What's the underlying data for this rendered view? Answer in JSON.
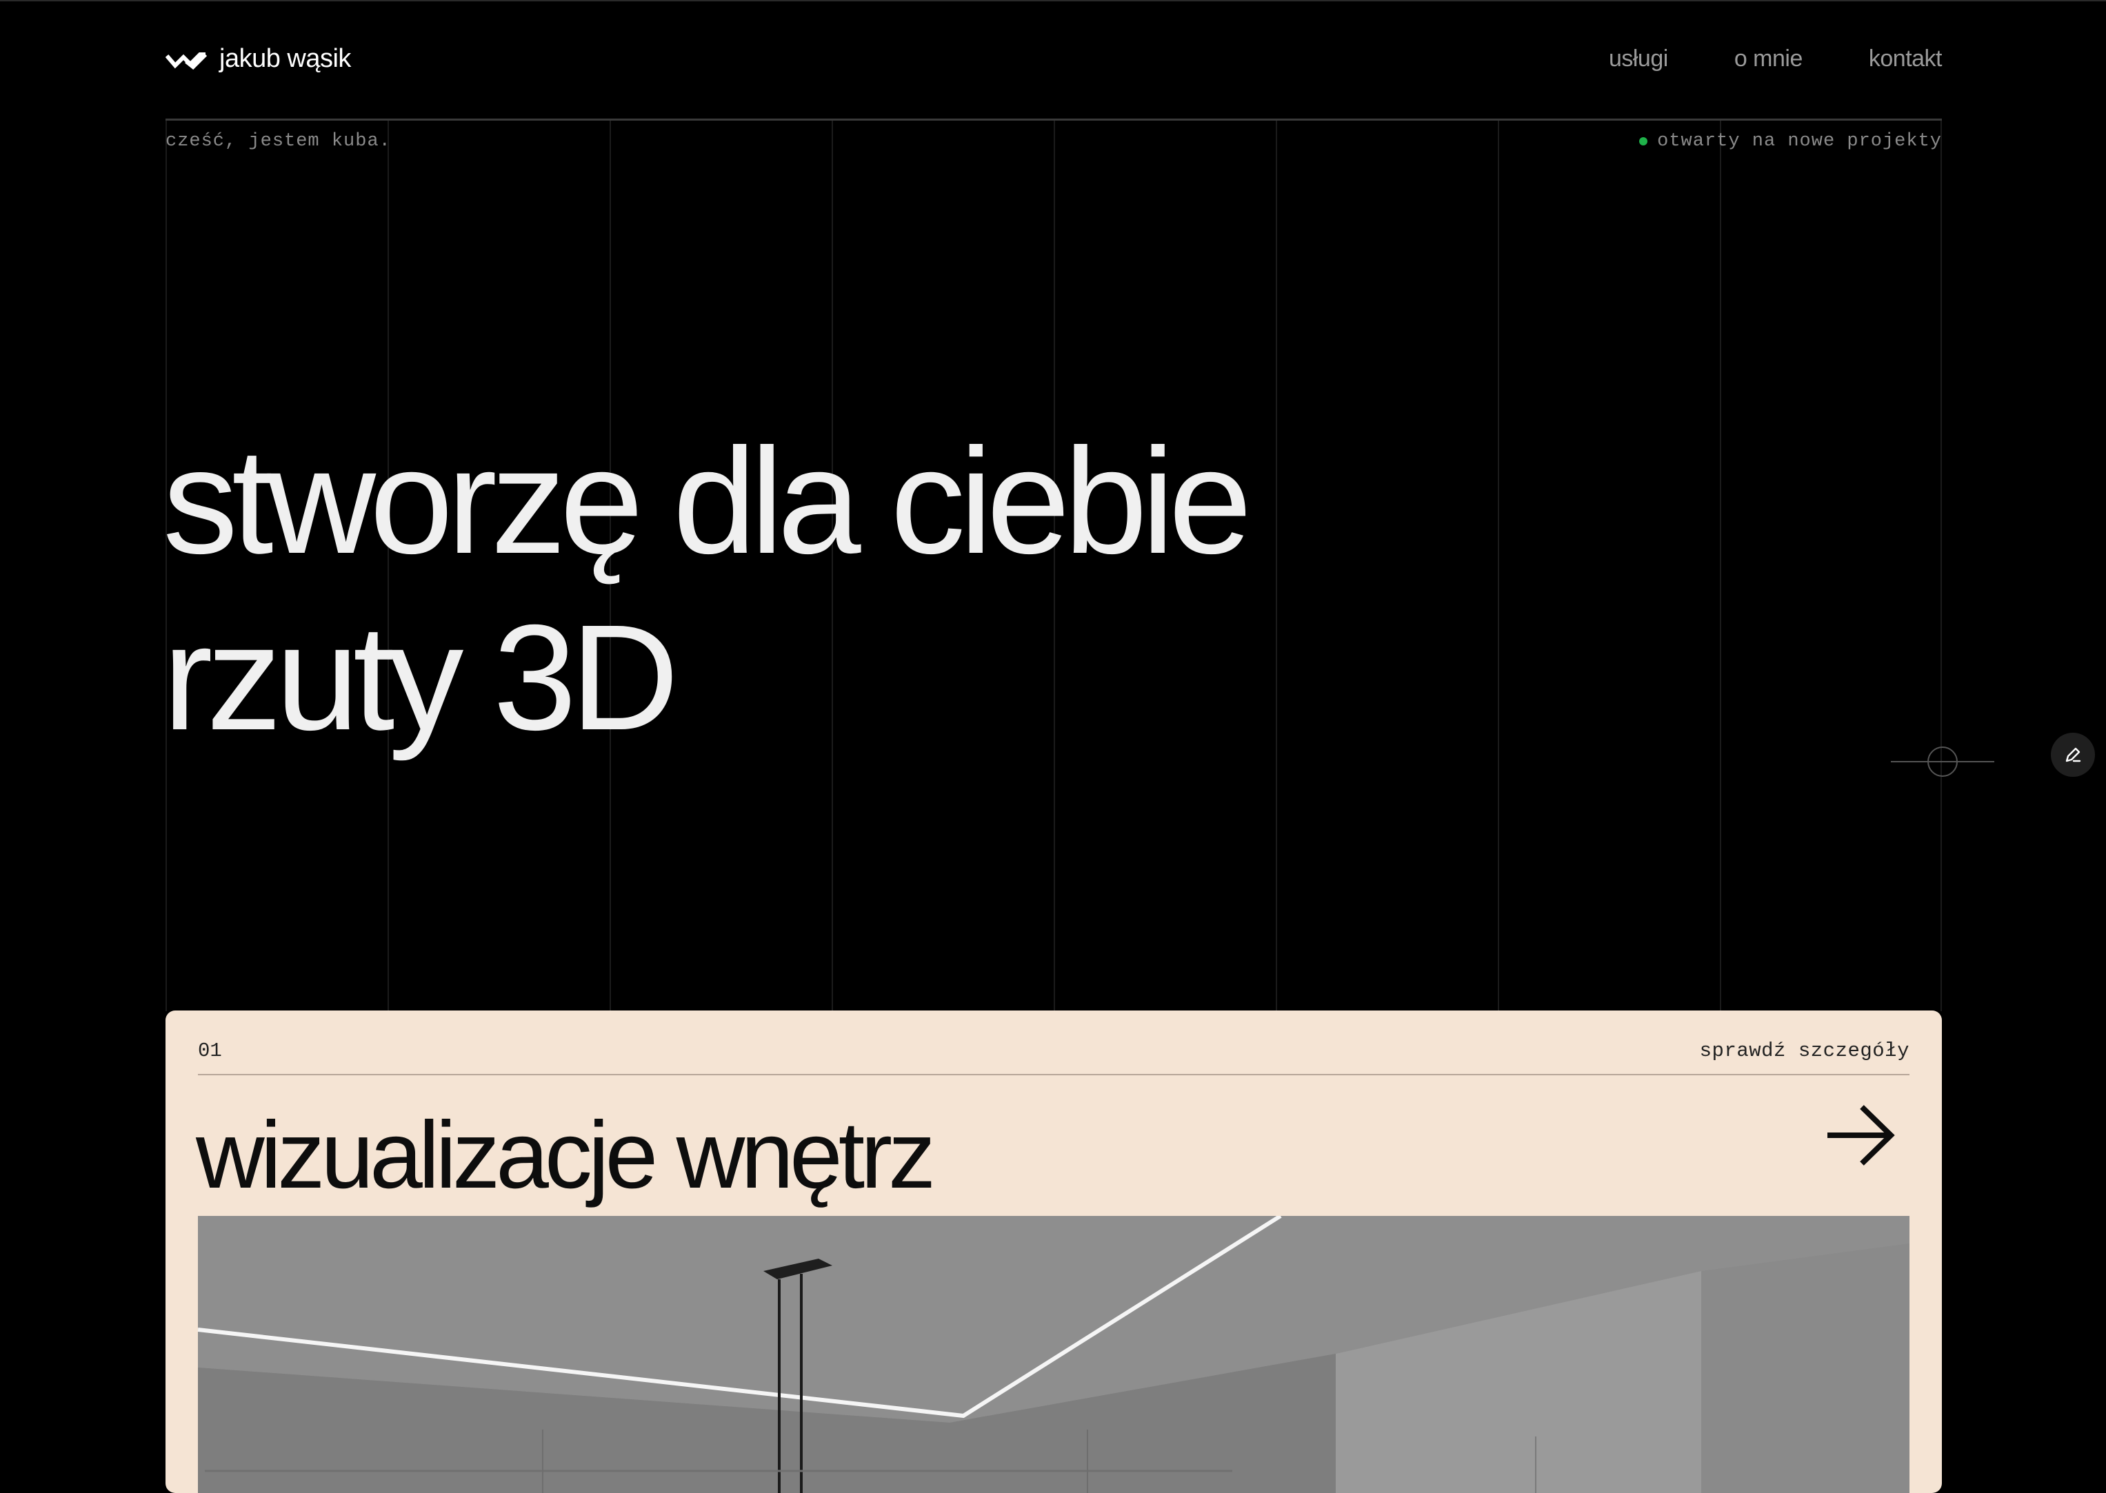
{
  "header": {
    "logo_icon": "w-logo-icon",
    "brand": "jakub wąsik",
    "nav": [
      {
        "label": "usługi"
      },
      {
        "label": "o mnie"
      },
      {
        "label": "kontakt"
      }
    ]
  },
  "intro": {
    "greeting": "cześć, jestem kuba.",
    "status": "otwarty na nowe projekty",
    "status_color": "#1fb24a"
  },
  "hero": {
    "line1": "stworzę dla ciebie",
    "line2": "rzuty 3D"
  },
  "side": {
    "edit_icon": "pencil-icon",
    "crosshair_icon": "crosshair-icon"
  },
  "service_card": {
    "number": "01",
    "link_label": "sprawdź szczegóły",
    "title": "wizualizacje wnętrz",
    "arrow_icon": "arrow-right-icon",
    "background": "#f5e4d4"
  }
}
